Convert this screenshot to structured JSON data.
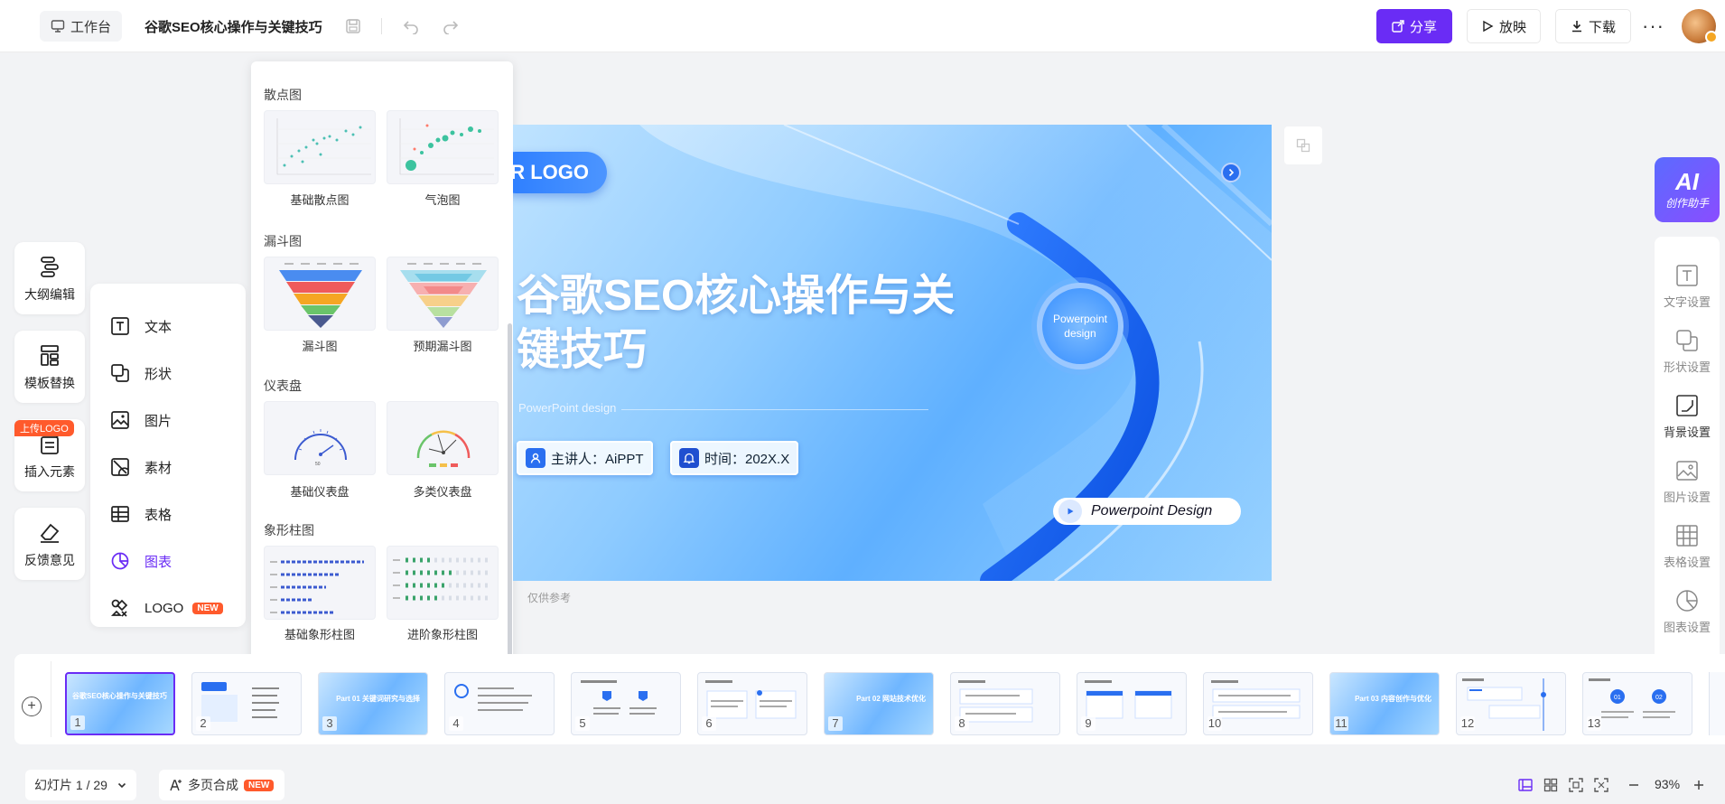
{
  "topbar": {
    "workspace_label": "工作台",
    "doc_title": "谷歌SEO核心操作与关键技巧",
    "share_label": "分享",
    "play_label": "放映",
    "download_label": "下载",
    "more_label": "···"
  },
  "left_tools": {
    "outline_label": "大纲编辑",
    "template_label": "模板替换",
    "insert_label": "插入元素",
    "upload_logo_badge": "上传LOGO",
    "feedback_label": "反馈意见"
  },
  "insert_menu": {
    "items": [
      {
        "label": "文本",
        "icon": "text-icon"
      },
      {
        "label": "形状",
        "icon": "shape-icon"
      },
      {
        "label": "图片",
        "icon": "image-icon"
      },
      {
        "label": "素材",
        "icon": "material-icon"
      },
      {
        "label": "表格",
        "icon": "table-icon"
      },
      {
        "label": "图表",
        "icon": "chart-icon",
        "active": true
      },
      {
        "label": "LOGO",
        "icon": "logo-icon",
        "badge": "NEW"
      }
    ]
  },
  "chart_panel": {
    "sections": [
      {
        "title": "散点图",
        "items": [
          "基础散点图",
          "气泡图"
        ]
      },
      {
        "title": "漏斗图",
        "items": [
          "漏斗图",
          "预期漏斗图"
        ]
      },
      {
        "title": "仪表盘",
        "items": [
          "基础仪表盘",
          "多类仪表盘"
        ]
      },
      {
        "title": "象形柱图",
        "items": [
          "基础象形柱图",
          "进阶象形柱图"
        ]
      }
    ]
  },
  "slide": {
    "logo_text": "R LOGO",
    "title_line1": "谷歌SEO核心操作与关",
    "title_line2": "键技巧",
    "subtitle": "PowerPoint design",
    "presenter": "主讲人：AiPPT",
    "time": "时间：202X.X",
    "circle_text_1": "Powerpoint",
    "circle_text_2": "design",
    "pill_text": "Powerpoint Design",
    "note": "仅供参考"
  },
  "right_panel": {
    "ai_big": "AI",
    "ai_small": "创作助手",
    "items": [
      "文字设置",
      "形状设置",
      "背景设置",
      "图片设置",
      "表格设置",
      "图表设置"
    ]
  },
  "filmstrip": {
    "thumbs": [
      {
        "num": "1",
        "title": "谷歌SEO核心操作与关键技巧"
      },
      {
        "num": "2",
        "title": ""
      },
      {
        "num": "3",
        "title": "Part 01 关键词研究与选择"
      },
      {
        "num": "4",
        "title": ""
      },
      {
        "num": "5",
        "title": ""
      },
      {
        "num": "6",
        "title": ""
      },
      {
        "num": "7",
        "title": "Part 02 网站技术优化"
      },
      {
        "num": "8",
        "title": ""
      },
      {
        "num": "9",
        "title": ""
      },
      {
        "num": "10",
        "title": ""
      },
      {
        "num": "11",
        "title": "Part 03 内容创作与优化"
      },
      {
        "num": "12",
        "title": ""
      },
      {
        "num": "13",
        "title": ""
      }
    ]
  },
  "bottombar": {
    "slide_count": "幻灯片 1 / 29",
    "merge_label": "多页合成",
    "merge_badge": "NEW",
    "zoom": "93%"
  },
  "colors": {
    "accent": "#6a2cf5",
    "new_badge": "#ff5a2c",
    "slide_blue": "#2a6ff0"
  }
}
